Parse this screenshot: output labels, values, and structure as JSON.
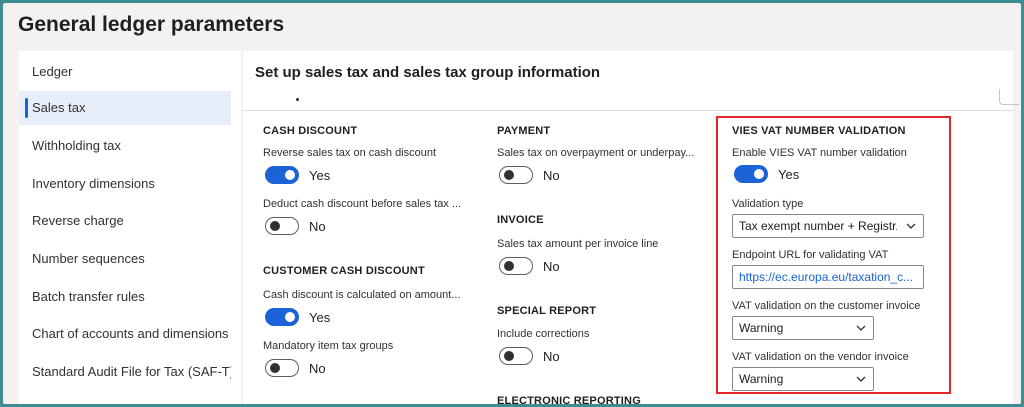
{
  "page": {
    "title": "General ledger parameters"
  },
  "sidebar": {
    "items": [
      {
        "label": "Ledger",
        "active": false
      },
      {
        "label": "Sales tax",
        "active": true
      },
      {
        "label": "Withholding tax",
        "active": false
      },
      {
        "label": "Inventory dimensions",
        "active": false
      },
      {
        "label": "Reverse charge",
        "active": false
      },
      {
        "label": "Number sequences",
        "active": false
      },
      {
        "label": "Batch transfer rules",
        "active": false
      },
      {
        "label": "Chart of accounts and dimensions",
        "active": false
      },
      {
        "label": "Standard Audit File for Tax (SAF-T)",
        "active": false
      }
    ]
  },
  "main": {
    "section_title": "Set up sales tax and sales tax group information",
    "cash_discount": {
      "title": "CASH DISCOUNT",
      "reverse_label": "Reverse sales tax on cash discount",
      "reverse_value": "Yes",
      "deduct_label": "Deduct cash discount before sales tax ...",
      "deduct_value": "No"
    },
    "customer_cash_discount": {
      "title": "CUSTOMER CASH DISCOUNT",
      "calculated_label": "Cash discount is calculated on amount...",
      "calculated_value": "Yes",
      "mandatory_label": "Mandatory item tax groups",
      "mandatory_value": "No"
    },
    "payment": {
      "title": "PAYMENT",
      "overpayment_label": "Sales tax on overpayment or underpay...",
      "overpayment_value": "No"
    },
    "invoice": {
      "title": "INVOICE",
      "per_line_label": "Sales tax amount per invoice line",
      "per_line_value": "No"
    },
    "special_report": {
      "title": "SPECIAL REPORT",
      "corrections_label": "Include corrections",
      "corrections_value": "No"
    },
    "electronic_reporting": {
      "title": "ELECTRONIC REPORTING"
    },
    "vies": {
      "title": "VIES VAT NUMBER VALIDATION",
      "enable_label": "Enable VIES VAT number validation",
      "enable_value": "Yes",
      "validation_type_label": "Validation type",
      "validation_type_value": "Tax exempt number + Registr...",
      "endpoint_label": "Endpoint URL for validating VAT",
      "endpoint_value": "https://ec.europa.eu/taxation_c...",
      "customer_label": "VAT validation on the customer invoice",
      "customer_value": "Warning",
      "vendor_label": "VAT validation on the vendor invoice",
      "vendor_value": "Warning"
    }
  },
  "colors": {
    "accent": "#1b63d6",
    "highlight": "#e3262b",
    "frame": "#3f8c92"
  }
}
